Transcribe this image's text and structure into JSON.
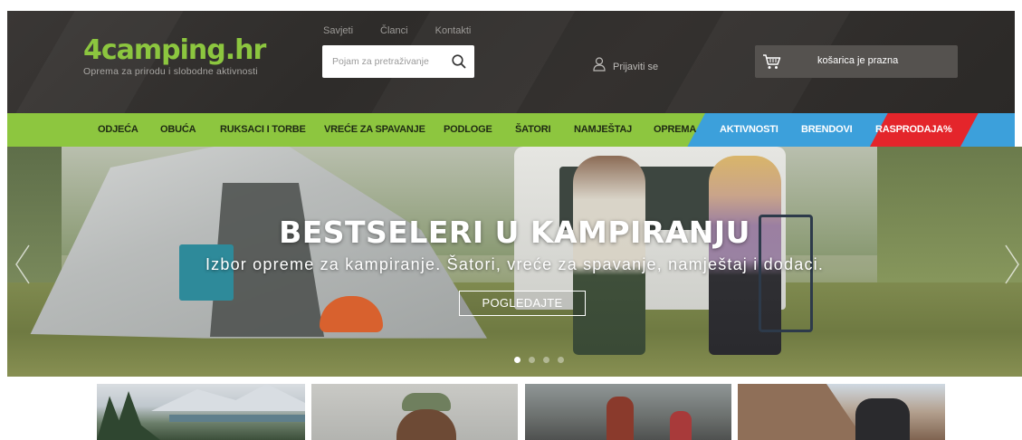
{
  "header": {
    "logo": {
      "text": "4camping.hr",
      "tagline": "Oprema za prirodu i slobodne aktivnosti"
    },
    "top_links": [
      "Savjeti",
      "Članci",
      "Kontakti"
    ],
    "search": {
      "placeholder": "Pojam za pretraživanje",
      "value": "",
      "icon": "search-icon"
    },
    "login": {
      "label": "Prijaviti se",
      "icon": "user-icon"
    },
    "cart": {
      "label": "košarica je prazna",
      "icon": "cart-icon"
    }
  },
  "main_nav": {
    "items": [
      "ODJEĆA",
      "OBUĆA",
      "RUKSACI I TORBE",
      "VREĆE ZA SPAVANJE",
      "PODLOGE",
      "ŠATORI",
      "NAMJEŠTAJ",
      "OPREMA"
    ],
    "special": [
      "AKTIVNOSTI",
      "BRENDOVI",
      "RASPRODAJA%"
    ],
    "colors": {
      "green": "#8dc63f",
      "blue": "#3ca0db",
      "red": "#e4252b"
    }
  },
  "hero": {
    "title": "BESTSELERI U KAMPIRANJU",
    "subtitle": "Izbor opreme za kampiranje. Šatori, vreće za spavanje, namještaj i dodaci.",
    "button": "POGLEDAJTE",
    "slides_count": 4,
    "active_slide": 1
  },
  "tiles": [
    "tile-mountains-lake",
    "tile-person-cap",
    "tile-hikers-rocks",
    "tile-climber"
  ]
}
